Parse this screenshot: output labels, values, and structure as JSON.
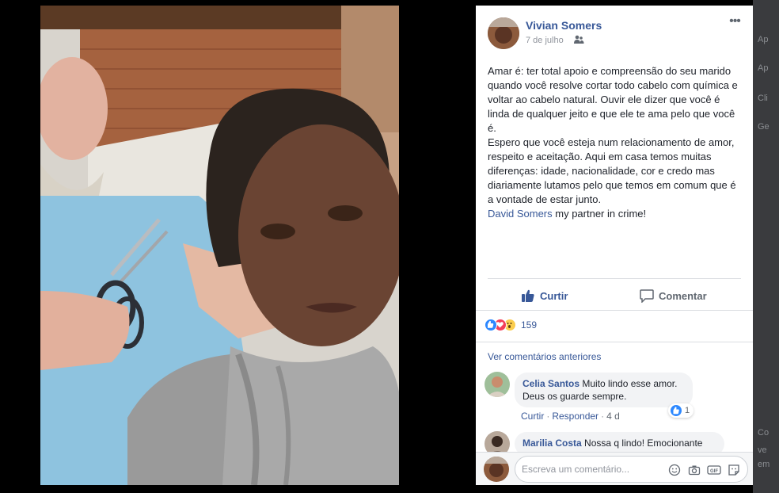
{
  "post": {
    "author": "Vivian Somers",
    "date": "7 de julho",
    "audience_icon": "friends-icon",
    "more_icon": "more-options-icon",
    "more_glyph": "•••",
    "text_paragraphs": [
      "Amar é: ter total apoio e compreensão do seu marido quando você resolve cortar todo cabelo com química e voltar ao cabelo natural. Ouvir ele dizer que você é linda de qualquer jeito e que ele te ama pelo que você é.",
      "Espero que você esteja num relacionamento de amor, respeito e aceitação. Aqui em casa temos muitas diferenças: idade, nacionalidade, cor e credo mas diariamente lutamos pelo que temos em comum que é a vontade de estar junto."
    ],
    "mention": "David Somers",
    "mention_suffix": " my partner in crime!"
  },
  "actions": {
    "like_label": "Curtir",
    "comment_label": "Comentar"
  },
  "reactions": {
    "types": [
      "like",
      "love",
      "wow"
    ],
    "count": "159"
  },
  "comments": {
    "see_previous": "Ver comentários anteriores",
    "items": [
      {
        "author": "Celia Santos",
        "text_line1": "Muito lindo esse amor.",
        "text_line2": "Deus os guarde sempre.",
        "like": "Curtir",
        "reply": "Responder",
        "time": "4 d",
        "likes": "1"
      },
      {
        "author": "Marilia Costa",
        "text_line1": "Nossa q lindo! Emocionante"
      }
    ]
  },
  "composer": {
    "placeholder": "Escreva um comentário..."
  },
  "colors": {
    "link": "#385898",
    "like_blue": "#2d88ff",
    "love_red": "#f33e58",
    "wow_yellow": "#fbcd4d"
  },
  "background_stubs": [
    "Ap",
    "Ap",
    "Cli",
    "Ge",
    "Co",
    "ve",
    "em"
  ]
}
